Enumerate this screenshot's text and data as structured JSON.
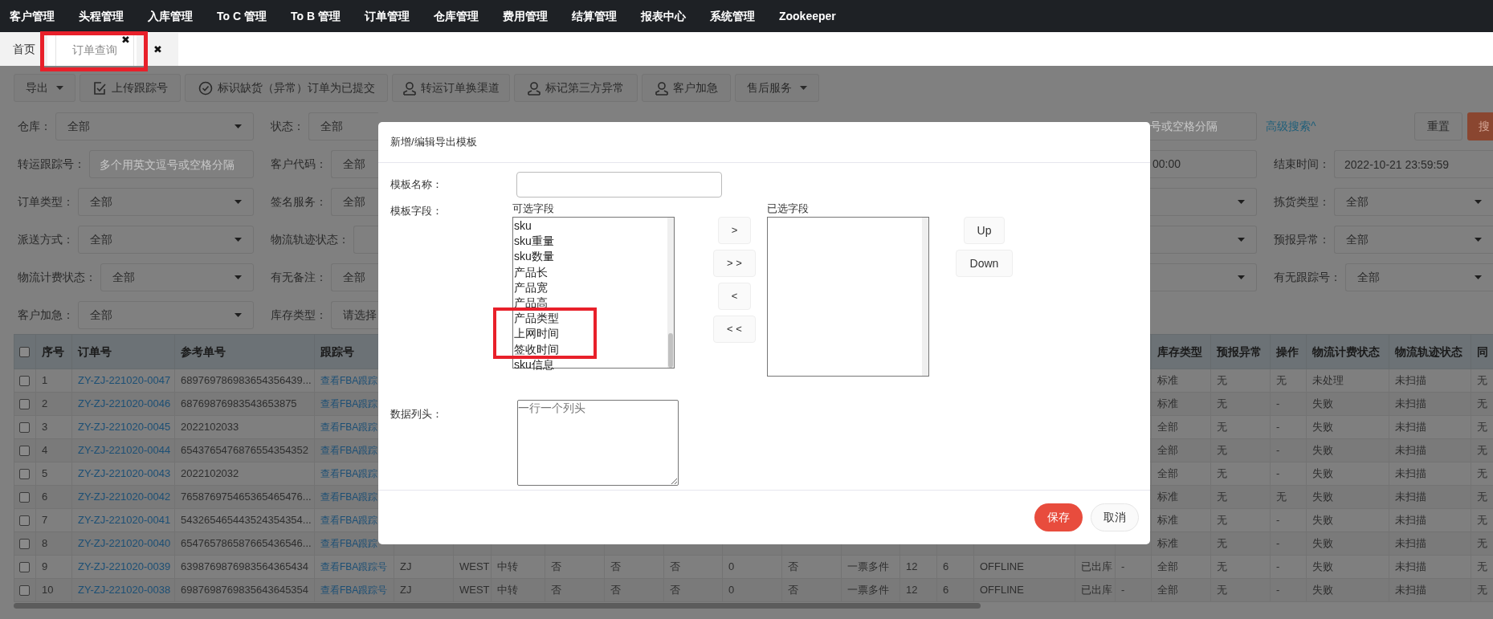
{
  "nav": {
    "items": [
      "客户管理",
      "头程管理",
      "入库管理",
      "To C 管理",
      "To B 管理",
      "订单管理",
      "仓库管理",
      "费用管理",
      "结算管理",
      "报表中心",
      "系统管理",
      "Zookeeper"
    ]
  },
  "tabs": [
    {
      "label": "首页",
      "selected": false
    },
    {
      "label": "订单查询",
      "selected": true,
      "close": "✖"
    }
  ],
  "close_all": "✖",
  "toolbar": [
    {
      "label": "导出",
      "kind": "plain",
      "dropdown": true
    },
    {
      "label": "上传跟踪号",
      "kind": "upload",
      "dropdown": false
    },
    {
      "label": "标识缺货（异常）订单为已提交",
      "kind": "confirm",
      "dropdown": false
    },
    {
      "label": "转运订单换渠道",
      "kind": "person",
      "dropdown": false
    },
    {
      "label": "标记第三方异常",
      "kind": "person",
      "dropdown": false
    },
    {
      "label": "客户加急",
      "kind": "person",
      "dropdown": false
    },
    {
      "label": "售后服务",
      "kind": "plain",
      "dropdown": true
    }
  ],
  "filters": [
    {
      "left": {
        "label": "仓库：",
        "kind": "select",
        "value": "全部"
      },
      "middle": {
        "label": "状态：",
        "kind": "select",
        "value": "全部"
      },
      "fragment": {
        "kind": "placeholder",
        "text": "号或空格分隔"
      },
      "actions": {
        "advanced": "高级搜索^",
        "reset": "重置",
        "search": "搜"
      }
    },
    {
      "left": {
        "label": "转运跟踪号：",
        "kind": "text",
        "placeholder": "多个用英文逗号或空格分隔"
      },
      "middle": {
        "label": "客户代码：",
        "kind": "select",
        "value": "全部"
      },
      "fragment": {
        "kind": "value",
        "text": "00:00"
      },
      "right": {
        "label": "结束时间：",
        "kind": "text",
        "value": "2022-10-21 23:59:59"
      }
    },
    {
      "left": {
        "label": "订单类型：",
        "kind": "select",
        "value": "全部"
      },
      "middle": {
        "label": "签名服务：",
        "kind": "select",
        "value": "全部"
      },
      "fragment": {
        "kind": "select"
      },
      "right": {
        "label": "拣货类型：",
        "kind": "select",
        "value": "全部"
      }
    },
    {
      "left": {
        "label": "派送方式：",
        "kind": "select",
        "value": "全部"
      },
      "middle": {
        "label": "物流轨迹状态：",
        "kind": "select"
      },
      "fragment": {
        "kind": "select"
      },
      "right": {
        "label": "预报异常：",
        "kind": "select",
        "value": "全部"
      }
    },
    {
      "left": {
        "label": "物流计费状态：",
        "kind": "select",
        "value": "全部"
      },
      "middle": {
        "label": "有无备注：",
        "kind": "select",
        "value": "全部"
      },
      "fragment": {
        "kind": "select"
      },
      "right": {
        "label": "有无跟踪号：",
        "kind": "select",
        "value": "全部"
      }
    },
    {
      "left": {
        "label": "客户加急：",
        "kind": "select",
        "value": "全部"
      },
      "middle": {
        "label": "库存类型：",
        "kind": "select",
        "value": "请选择"
      }
    }
  ],
  "table": {
    "all_checked": false,
    "columns_left": [
      "序号",
      "订单号",
      "参考单号",
      "跟踪号"
    ],
    "columns_right": [
      "库存类型",
      "预报异常",
      "操作",
      "物流计费状态",
      "物流轨迹状态",
      "同"
    ],
    "rows": [
      {
        "checked": false,
        "no": "1",
        "order": "ZY-ZJ-221020-0047",
        "ref": "689769786983654356439...",
        "tracking": "查看FBA跟踪",
        "right": [
          "标准",
          "无",
          "无",
          "未处理",
          "未扫描",
          "无"
        ]
      },
      {
        "checked": false,
        "no": "2",
        "order": "ZY-ZJ-221020-0046",
        "ref": "68769876983543653875",
        "tracking": "查看FBA跟踪",
        "right": [
          "标准",
          "无",
          "-",
          "失败",
          "未扫描",
          "无"
        ]
      },
      {
        "checked": false,
        "no": "3",
        "order": "ZY-ZJ-221020-0045",
        "ref": "2022102033",
        "tracking": "查看FBA跟踪",
        "right": [
          "全部",
          "无",
          "-",
          "失败",
          "未扫描",
          "无"
        ]
      },
      {
        "checked": false,
        "no": "4",
        "order": "ZY-ZJ-221020-0044",
        "ref": "6543765476876554354352",
        "tracking": "查看FBA跟踪",
        "right": [
          "全部",
          "无",
          "-",
          "失败",
          "未扫描",
          "无"
        ]
      },
      {
        "checked": false,
        "no": "5",
        "order": "ZY-ZJ-221020-0043",
        "ref": "2022102032",
        "tracking": "查看FBA跟踪",
        "right": [
          "全部",
          "无",
          "-",
          "失败",
          "未扫描",
          "无"
        ]
      },
      {
        "checked": false,
        "no": "6",
        "order": "ZY-ZJ-221020-0042",
        "ref": "765876975465365465476...",
        "tracking": "查看FBA跟踪",
        "right": [
          "标准",
          "无",
          "无",
          "失败",
          "未扫描",
          "无"
        ]
      },
      {
        "checked": false,
        "no": "7",
        "order": "ZY-ZJ-221020-0041",
        "ref": "543265465443524354354...",
        "tracking": "查看FBA跟踪",
        "right": [
          "标准",
          "无",
          "-",
          "失败",
          "未扫描",
          "无"
        ]
      },
      {
        "checked": false,
        "no": "8",
        "order": "ZY-ZJ-221020-0040",
        "ref": "654765786587665436546...",
        "tracking": "查看FBA跟踪",
        "right": [
          "标准",
          "无",
          "-",
          "失败",
          "未扫描",
          "无"
        ]
      },
      {
        "checked": false,
        "no": "9",
        "order": "ZY-ZJ-221020-0039",
        "ref": "6398769876983564365434",
        "tracking": "查看FBA跟踪号",
        "middle": [
          "ZJ",
          "WEST",
          "中转",
          "否",
          "否",
          "否",
          "0",
          "否",
          "一票多件",
          "12",
          "6",
          "OFFLINE",
          "已出库",
          "-"
        ],
        "right": [
          "全部",
          "无",
          "-",
          "失败",
          "未扫描",
          "无"
        ]
      },
      {
        "checked": false,
        "no": "10",
        "order": "ZY-ZJ-221020-0038",
        "ref": "6987698769835643645354",
        "tracking": "查看FBA跟踪号",
        "middle": [
          "ZJ",
          "WEST",
          "中转",
          "否",
          "否",
          "否",
          "0",
          "否",
          "一票多件",
          "12",
          "6",
          "OFFLINE",
          "已出库",
          "-"
        ],
        "right": [
          "全部",
          "无",
          "-",
          "失败",
          "未扫描",
          "无"
        ]
      }
    ]
  },
  "modal": {
    "title": "新增/编辑导出模板",
    "name_label": "模板名称：",
    "fields_label": "模板字段：",
    "available_label": "可选字段",
    "available": [
      "sku",
      "sku重量",
      "sku数量",
      "产品长",
      "产品宽",
      "产品高",
      "产品类型",
      "上网时间",
      "签收时间",
      "sku信息"
    ],
    "selected_label": "已选字段",
    "move_buttons": [
      ">",
      "> >",
      "<",
      "< <"
    ],
    "order_buttons": [
      "Up",
      "Down"
    ],
    "header_label": "数据列头：",
    "header_placeholder": "一行一个列头",
    "save": "保存",
    "cancel": "取消"
  }
}
